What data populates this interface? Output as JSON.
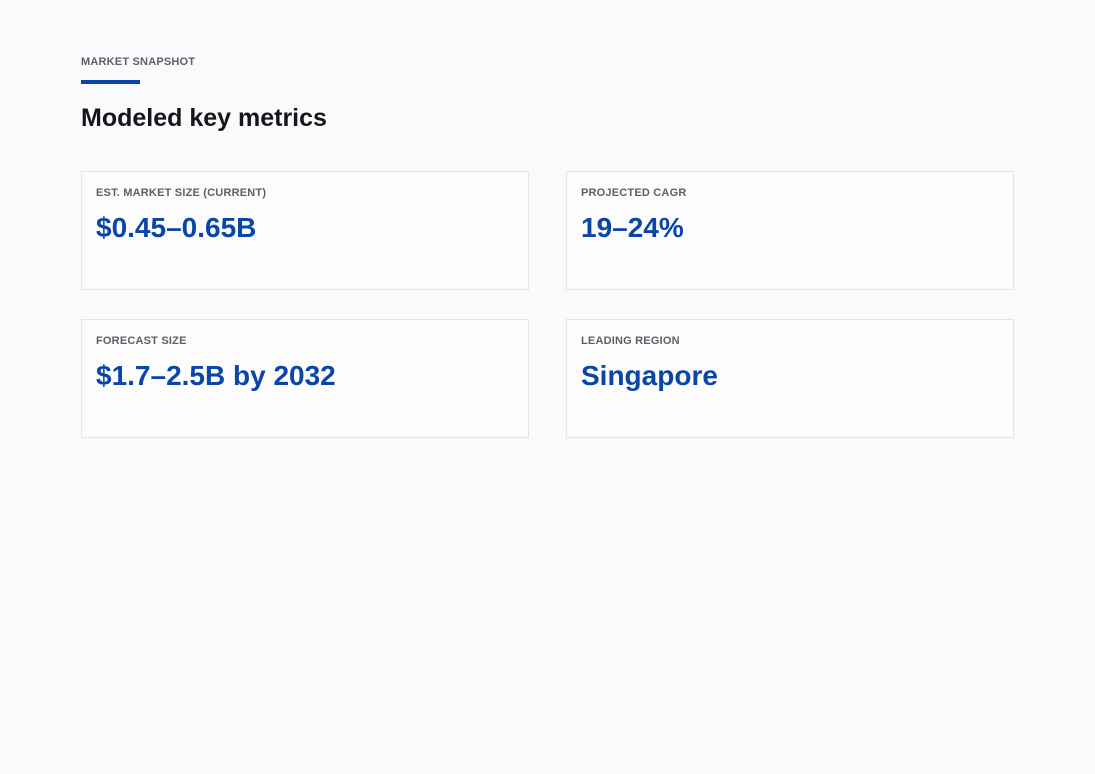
{
  "section": {
    "eyebrow": "MARKET SNAPSHOT",
    "title": "Modeled key metrics"
  },
  "metrics": [
    {
      "label": "EST. MARKET SIZE (CURRENT)",
      "value": "$0.45–0.65B"
    },
    {
      "label": "PROJECTED CAGR",
      "value": "19–24%"
    },
    {
      "label": "FORECAST SIZE",
      "value": "$1.7–2.5B by 2032"
    },
    {
      "label": "LEADING REGION",
      "value": "Singapore"
    }
  ],
  "colors": {
    "accent": "#0a46a8",
    "background": "#fafafc",
    "card_border": "#e3e4e8",
    "label": "#5c5f6a",
    "heading": "#16161a"
  }
}
